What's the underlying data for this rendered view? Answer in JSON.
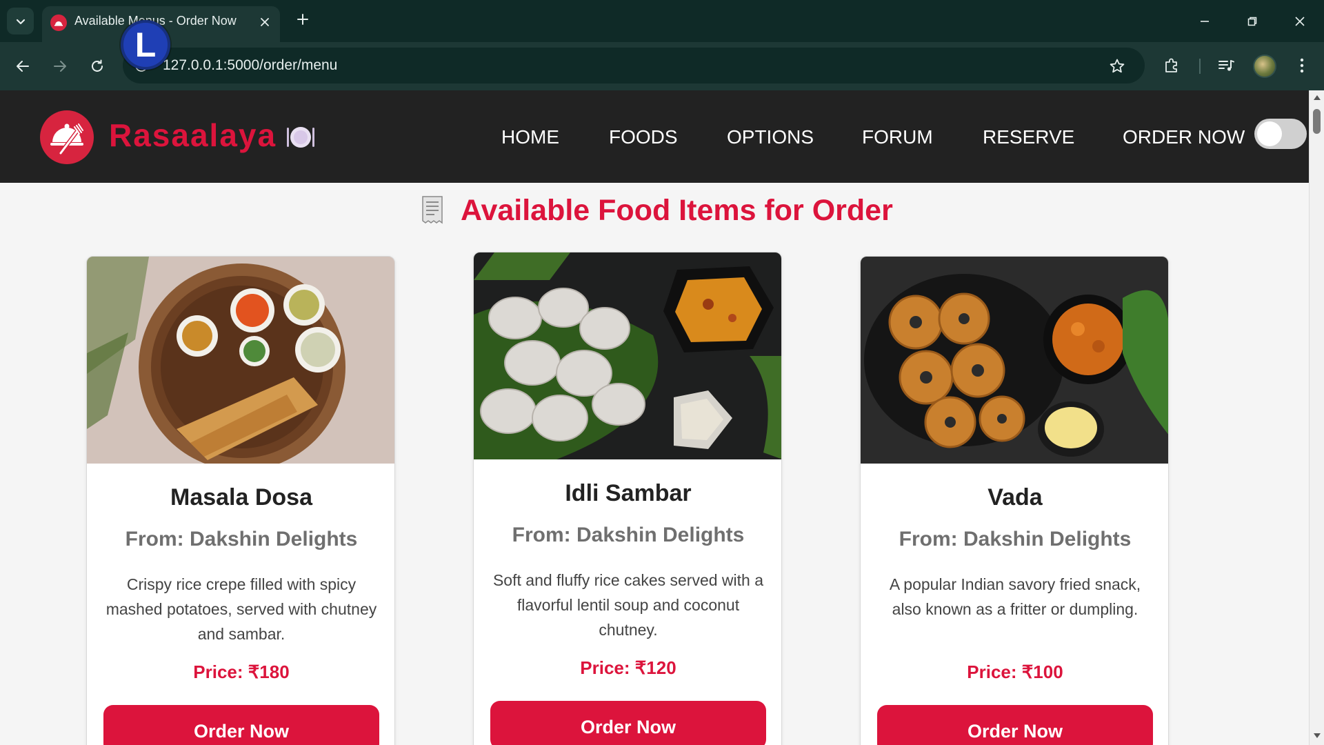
{
  "browser": {
    "tab_title": "Available Menus - Order Now",
    "url": "127.0.0.1:5000/order/menu",
    "overlay_letter": "L"
  },
  "site": {
    "brand": "Rasaalaya",
    "nav": [
      "HOME",
      "FOODS",
      "OPTIONS",
      "FORUM",
      "RESERVE",
      "ORDER NOW"
    ],
    "theme_toggle_on": false
  },
  "page": {
    "heading": "Available Food Items for Order"
  },
  "items": [
    {
      "name": "Masala Dosa",
      "restaurant": "From: Dakshin Delights",
      "description": "Crispy rice crepe filled with spicy mashed potatoes, served with chutney and sambar.",
      "price": "Price: ₹180",
      "button": "Order Now"
    },
    {
      "name": "Idli Sambar",
      "restaurant": "From: Dakshin Delights",
      "description": "Soft and fluffy rice cakes served with a flavorful lentil soup and coconut chutney.",
      "price": "Price: ₹120",
      "button": "Order Now"
    },
    {
      "name": "Vada",
      "restaurant": "From: Dakshin Delights",
      "description": "A popular Indian savory fried snack, also known as a fritter or dumpling.",
      "price": "Price: ₹100",
      "button": "Order Now"
    }
  ],
  "colors": {
    "accent": "#dc143c",
    "nav_bg": "#222222",
    "chrome_dark": "#0f2a27",
    "chrome_toolbar": "#1d3835"
  }
}
